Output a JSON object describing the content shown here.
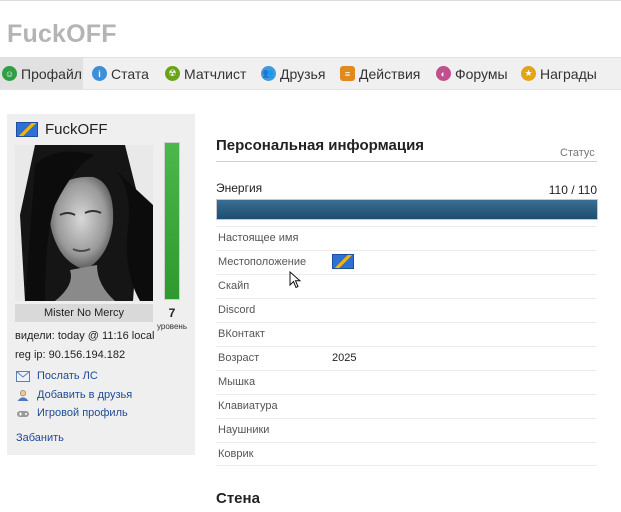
{
  "site": {
    "title": "FuckOFF"
  },
  "nav": {
    "items": [
      {
        "label": "Профайл",
        "icon": "smile-icon",
        "color": "#2ea043"
      },
      {
        "label": "Стата",
        "icon": "info-icon",
        "color": "#3d8fd8"
      },
      {
        "label": "Матчлист",
        "icon": "radiation-icon",
        "color": "#6aa318"
      },
      {
        "label": "Друзья",
        "icon": "users-icon",
        "color": "#4499d6"
      },
      {
        "label": "Действия",
        "icon": "scroll-icon",
        "color": "#e08a1e"
      },
      {
        "label": "Форумы",
        "icon": "forum-icon",
        "color": "#c04f8e"
      },
      {
        "label": "Награды",
        "icon": "medal-icon",
        "color": "#e3a514"
      }
    ],
    "active_index": 0
  },
  "profile": {
    "name": "FuckOFF",
    "nickname": "Mister No Mercy",
    "level": "7",
    "level_label": "уровень",
    "level_fill_percent": 100,
    "seen": "видели: today @ 11:16 local",
    "reg_ip": "reg ip: 90.156.194.182",
    "actions": [
      {
        "label": "Послать ЛС",
        "icon": "mail-icon"
      },
      {
        "label": "Добавить в друзья",
        "icon": "add-friend-icon"
      },
      {
        "label": "Игровой профиль",
        "icon": "gamepad-icon"
      }
    ],
    "ban_label": "Забанить"
  },
  "info": {
    "title": "Персональная информация",
    "status_label": "Статус",
    "energy_label": "Энергия",
    "energy_value": "110 / 110",
    "energy_fraction": 1.0,
    "rows": [
      {
        "label": "Настоящее имя",
        "value": ""
      },
      {
        "label": "Местоположение",
        "value": "",
        "flag": true
      },
      {
        "label": "Скайп",
        "value": ""
      },
      {
        "label": "Discord",
        "value": ""
      },
      {
        "label": "ВКонтакт",
        "value": ""
      },
      {
        "label": "Возраст",
        "value": "2025"
      },
      {
        "label": "Мышка",
        "value": ""
      },
      {
        "label": "Клавиатура",
        "value": ""
      },
      {
        "label": "Наушники",
        "value": ""
      },
      {
        "label": "Коврик",
        "value": ""
      }
    ]
  },
  "wall": {
    "title": "Стена"
  }
}
